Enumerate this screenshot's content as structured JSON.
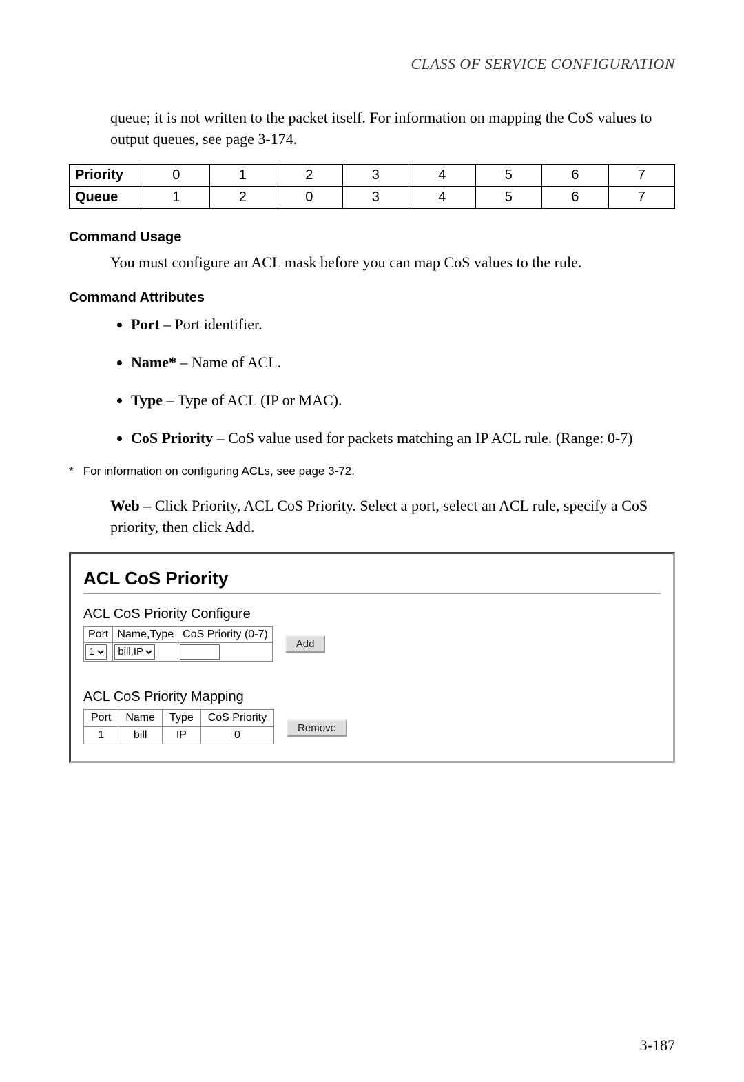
{
  "running_head": "CLASS OF SERVICE CONFIGURATION",
  "intro_para": "queue; it is not written to the packet itself. For information on mapping the CoS values to output queues, see page 3-174.",
  "priority_table": {
    "row1_label": "Priority",
    "row1": [
      "0",
      "1",
      "2",
      "3",
      "4",
      "5",
      "6",
      "7"
    ],
    "row2_label": "Queue",
    "row2": [
      "1",
      "2",
      "0",
      "3",
      "4",
      "5",
      "6",
      "7"
    ]
  },
  "sect_usage_head": "Command Usage",
  "usage_text": "You must configure an ACL mask before you can map CoS values to the rule.",
  "sect_attr_head": "Command Attributes",
  "attrs": [
    {
      "term": "Port",
      "desc": " – Port identifier."
    },
    {
      "term": "Name*",
      "desc": " – Name of ACL."
    },
    {
      "term": "Type",
      "desc": " – Type of ACL (IP or MAC)."
    },
    {
      "term": "CoS Priority",
      "desc": " – CoS value used for packets matching an IP ACL rule. (Range: 0-7)"
    }
  ],
  "footnote_marker": "*",
  "footnote_text": "For information on configuring ACLs, see page 3-72.",
  "web_lead": "Web",
  "web_text": " – Click Priority, ACL CoS Priority. Select a port, select an ACL rule, specify a CoS priority, then click Add.",
  "screenshot": {
    "title": "ACL CoS Priority",
    "configure_head": "ACL CoS Priority Configure",
    "cfg_headers": {
      "port": "Port",
      "name_type": "Name,Type",
      "cos": "CoS Priority (0-7)"
    },
    "port_value": "1",
    "name_type_value": "bill,IP",
    "cos_value": "",
    "add_btn": "Add",
    "mapping_head": "ACL CoS Priority Mapping",
    "map_headers": {
      "port": "Port",
      "name": "Name",
      "type": "Type",
      "cos": "CoS Priority"
    },
    "map_row": {
      "port": "1",
      "name": "bill",
      "type": "IP",
      "cos": "0"
    },
    "remove_btn": "Remove"
  },
  "page_number": "3-187"
}
